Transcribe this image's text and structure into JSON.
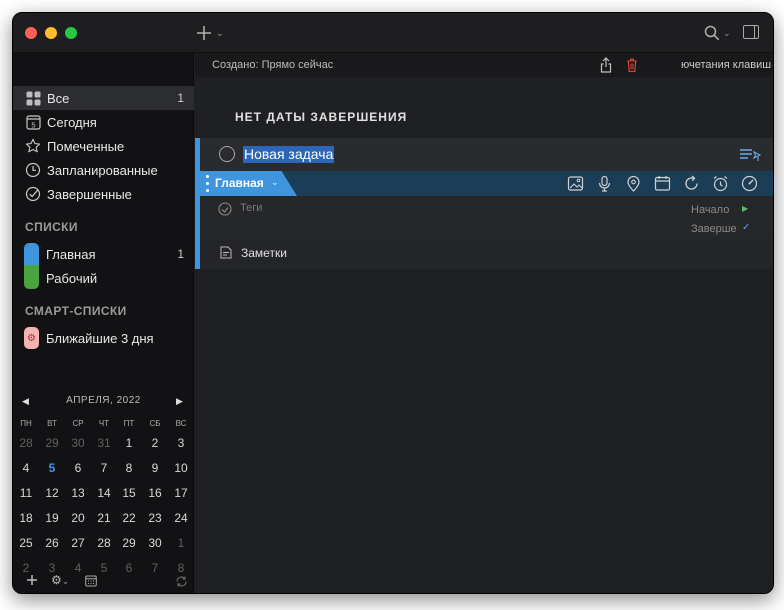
{
  "sidebar": {
    "items": [
      {
        "label": "Все",
        "count": "1",
        "icon": "grid-icon"
      },
      {
        "label": "Сегодня",
        "count": "",
        "icon": "calendar-day-icon",
        "badge": "5"
      },
      {
        "label": "Помеченные",
        "count": "",
        "icon": "star-icon"
      },
      {
        "label": "Запланированные",
        "count": "",
        "icon": "clock-icon"
      },
      {
        "label": "Завершенные",
        "count": "",
        "icon": "check-circle-icon"
      }
    ],
    "lists_header": "СПИСКИ",
    "lists": [
      {
        "label": "Главная",
        "count": "1",
        "color": "#3e95dd"
      },
      {
        "label": "Рабочий",
        "count": "",
        "color": "#4aa33c"
      }
    ],
    "smart_header": "СМАРТ-СПИСКИ",
    "smart_lists": [
      {
        "label": "Ближайшие 3 дня",
        "color": "#f3b3b3"
      }
    ]
  },
  "calendar": {
    "month_label": "АПРЕЛЯ, 2022",
    "weekdays": [
      "ПН",
      "ВТ",
      "СР",
      "ЧТ",
      "ПТ",
      "СБ",
      "ВС"
    ],
    "weeks": [
      [
        "28",
        "29",
        "30",
        "31",
        "1",
        "2",
        "3"
      ],
      [
        "4",
        "5",
        "6",
        "7",
        "8",
        "9",
        "10"
      ],
      [
        "11",
        "12",
        "13",
        "14",
        "15",
        "16",
        "17"
      ],
      [
        "18",
        "19",
        "20",
        "21",
        "22",
        "23",
        "24"
      ],
      [
        "25",
        "26",
        "27",
        "28",
        "29",
        "30",
        "1"
      ],
      [
        "2",
        "3",
        "4",
        "5",
        "6",
        "7",
        "8"
      ]
    ],
    "today": "5"
  },
  "info_bar": {
    "created": "Создано: Прямо сейчас",
    "shortcut_hint": "ючетания клавиш"
  },
  "main": {
    "heading": "НЕТ ДАТЫ ЗАВЕРШЕНИЯ"
  },
  "task": {
    "title": "Новая задача",
    "list_name": "Главная",
    "tags_placeholder": "Теги",
    "start_label": "Начало",
    "due_label": "Завершение",
    "notes_label": "Заметки"
  },
  "colors": {
    "accent": "#3e95dd",
    "selection": "#2c66b8",
    "today": "#3f96e6",
    "trash": "#e0483a"
  }
}
